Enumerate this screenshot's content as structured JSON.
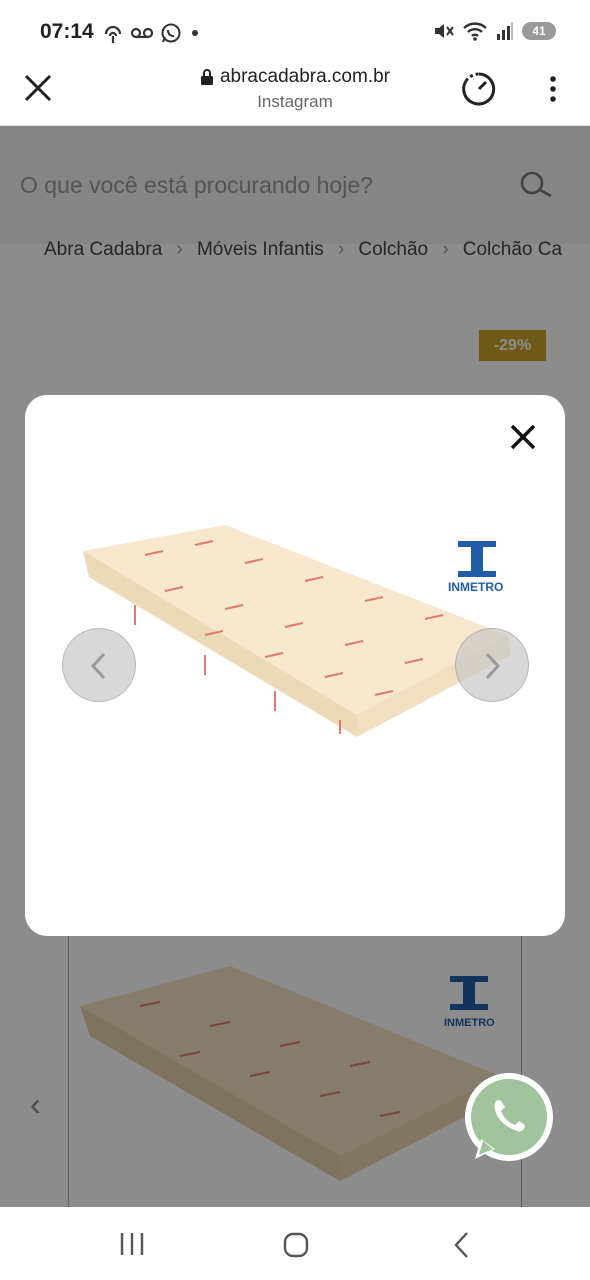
{
  "status_bar": {
    "time": "07:14",
    "battery_level": "41",
    "icons_left": [
      "hotspot-icon",
      "voicemail-icon",
      "whatsapp-icon",
      "dot-icon"
    ],
    "icons_right": [
      "mute-icon",
      "wifi-icon",
      "signal-icon",
      "battery-icon"
    ]
  },
  "browser": {
    "url": "abracadabra.com.br",
    "source": "Instagram",
    "lock_icon": "lock-icon",
    "close_icon": "close-icon",
    "speed_icon": "speed-icon",
    "menu_icon": "more-vert-icon"
  },
  "search": {
    "placeholder": "O que você está procurando hoje?"
  },
  "breadcrumb": [
    "Abra Cadabra",
    "Móveis Infantis",
    "Colchão",
    "Colchão Ca"
  ],
  "product": {
    "discount": "-29%",
    "brand_logo_text": "INMETRO"
  },
  "modal": {
    "close_icon": "close-icon",
    "prev_icon": "chevron-left-icon",
    "next_icon": "chevron-right-icon",
    "logo_text": "INMETRO"
  },
  "colors": {
    "discount_badge": "#c9a227",
    "mattress": "#f3e2c4",
    "mattress_print": "#d9534f",
    "inmetro_blue": "#1f5da8",
    "whatsapp_green": "#25d366"
  }
}
